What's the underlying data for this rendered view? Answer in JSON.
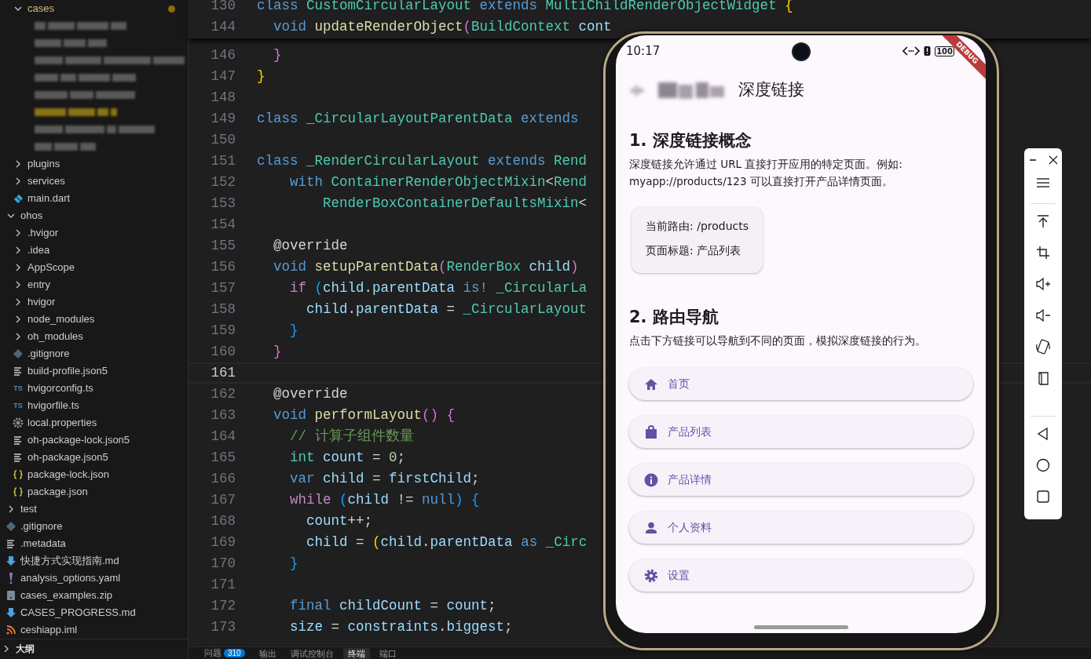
{
  "explorer": {
    "tree": [
      {
        "children": [
          {
            "label": "cases",
            "kind": "folder",
            "expanded": true,
            "modified": true,
            "children": [
              {
                "kind": "redacted",
                "modified": false
              },
              {
                "kind": "redacted",
                "modified": false
              },
              {
                "kind": "redacted",
                "modified": false
              },
              {
                "kind": "redacted",
                "modified": false
              },
              {
                "kind": "redacted",
                "modified": false
              },
              {
                "kind": "redacted",
                "modified": true
              },
              {
                "kind": "redacted",
                "modified": false
              },
              {
                "kind": "redacted",
                "modified": false
              }
            ]
          },
          {
            "label": "plugins",
            "kind": "folder",
            "expanded": false,
            "modified": false
          },
          {
            "label": "services",
            "kind": "folder",
            "expanded": false,
            "modified": false
          },
          {
            "label": "main.dart",
            "kind": "dart",
            "modified": false
          }
        ]
      },
      {
        "label": "ohos",
        "kind": "folder",
        "expanded": true,
        "modified": false,
        "children": [
          {
            "label": ".hvigor",
            "kind": "folder",
            "expanded": false,
            "modified": false
          },
          {
            "label": ".idea",
            "kind": "folder",
            "expanded": false,
            "modified": false
          },
          {
            "label": "AppScope",
            "kind": "folder",
            "expanded": false,
            "modified": false
          },
          {
            "label": "entry",
            "kind": "folder",
            "expanded": false,
            "modified": false
          },
          {
            "label": "hvigor",
            "kind": "folder",
            "expanded": false,
            "modified": false
          },
          {
            "label": "node_modules",
            "kind": "folder",
            "expanded": false,
            "modified": false
          },
          {
            "label": "oh_modules",
            "kind": "folder",
            "expanded": false,
            "modified": false
          },
          {
            "label": ".gitignore",
            "kind": "git",
            "modified": false
          },
          {
            "label": "build-profile.json5",
            "kind": "lines",
            "modified": false
          },
          {
            "label": "hvigorconfig.ts",
            "kind": "ts",
            "icon_text": "TS",
            "modified": false
          },
          {
            "label": "hvigorfile.ts",
            "kind": "ts",
            "icon_text": "TS",
            "modified": false
          },
          {
            "label": "local.properties",
            "kind": "gear",
            "modified": false
          },
          {
            "label": "oh-package-lock.json5",
            "kind": "lines",
            "modified": false
          },
          {
            "label": "oh-package.json5",
            "kind": "lines",
            "modified": false
          },
          {
            "label": "package-lock.json",
            "kind": "json",
            "modified": false
          },
          {
            "label": "package.json",
            "kind": "json",
            "modified": false
          }
        ]
      },
      {
        "label": "test",
        "kind": "folder",
        "expanded": false,
        "modified": false
      },
      {
        "label": ".gitignore",
        "kind": "git",
        "modified": false
      },
      {
        "label": ".metadata",
        "kind": "lines",
        "modified": false
      },
      {
        "label": "快捷方式实现指南.md",
        "kind": "markdown",
        "modified": false
      },
      {
        "label": "analysis_options.yaml",
        "kind": "yaml",
        "modified": false
      },
      {
        "label": "cases_examples.zip",
        "kind": "zip",
        "modified": false
      },
      {
        "label": "CASES_PROGRESS.md",
        "kind": "markdown",
        "modified": false
      },
      {
        "label": "ceshiapp.iml",
        "kind": "feed",
        "modified": false
      }
    ],
    "outline": {
      "label": "大纲",
      "expanded": false
    }
  },
  "editor": {
    "sticky_lines": [
      {
        "number": "130",
        "tokens": [
          {
            "kind": "kw",
            "text": "class"
          },
          {
            "kind": "ty",
            "text": " CustomCircularLayout"
          },
          {
            "kind": "kw",
            "text": " extends"
          },
          {
            "kind": "ty",
            "text": " MultiChildRenderObjectWidget"
          },
          {
            "kind": "b1",
            "text": " {"
          }
        ]
      },
      {
        "number": "144",
        "tokens": [
          {
            "kind": "kw",
            "text": "  void"
          },
          {
            "kind": "fn",
            "text": " updateRenderObject"
          },
          {
            "kind": "b2",
            "text": "("
          },
          {
            "kind": "ty",
            "text": "BuildContext"
          },
          {
            "kind": "va",
            "text": " cont"
          }
        ]
      }
    ],
    "lines": [
      {
        "number": "146",
        "current": false,
        "tokens": [
          {
            "kind": "b2",
            "text": "  }"
          }
        ]
      },
      {
        "number": "147",
        "current": false,
        "tokens": [
          {
            "kind": "b1",
            "text": "}"
          }
        ]
      },
      {
        "number": "148",
        "current": false
      },
      {
        "number": "149",
        "current": false,
        "tokens": [
          {
            "kind": "kw",
            "text": "class"
          },
          {
            "kind": "ty",
            "text": " _CircularLayoutParentData"
          },
          {
            "kind": "kw",
            "text": " extends"
          }
        ]
      },
      {
        "number": "150",
        "current": false
      },
      {
        "number": "151",
        "current": false,
        "tokens": [
          {
            "kind": "kw",
            "text": "class"
          },
          {
            "kind": "ty",
            "text": " _RenderCircularLayout"
          },
          {
            "kind": "kw",
            "text": " extends"
          },
          {
            "kind": "ty",
            "text": " Rend"
          }
        ]
      },
      {
        "number": "152",
        "current": false,
        "tokens": [
          {
            "kind": "kw",
            "text": "    with"
          },
          {
            "kind": "ty",
            "text": " ContainerRenderObjectMixin"
          },
          {
            "kind": "p",
            "text": "<"
          },
          {
            "kind": "ty",
            "text": "Rend"
          }
        ]
      },
      {
        "number": "153",
        "current": false,
        "tokens": [
          {
            "kind": "ty",
            "text": "        RenderBoxContainerDefaultsMixin"
          },
          {
            "kind": "p",
            "text": "<"
          }
        ]
      },
      {
        "number": "154",
        "current": false
      },
      {
        "number": "155",
        "current": false,
        "tokens": [
          {
            "kind": "p",
            "text": "  @override"
          }
        ]
      },
      {
        "number": "156",
        "current": false,
        "tokens": [
          {
            "kind": "kw",
            "text": "  void"
          },
          {
            "kind": "fn",
            "text": " setupParentData"
          },
          {
            "kind": "b2",
            "text": "("
          },
          {
            "kind": "ty",
            "text": "RenderBox"
          },
          {
            "kind": "va",
            "text": " child"
          },
          {
            "kind": "b2",
            "text": ")"
          }
        ]
      },
      {
        "number": "157",
        "current": false,
        "tokens": [
          {
            "kind": "ct",
            "text": "    if"
          },
          {
            "kind": "b3",
            "text": " ("
          },
          {
            "kind": "va",
            "text": "child"
          },
          {
            "kind": "p",
            "text": "."
          },
          {
            "kind": "va",
            "text": "parentData"
          },
          {
            "kind": "kw",
            "text": " is!"
          },
          {
            "kind": "ty",
            "text": " _CircularLa"
          }
        ]
      },
      {
        "number": "158",
        "current": false,
        "tokens": [
          {
            "kind": "va",
            "text": "      child"
          },
          {
            "kind": "p",
            "text": "."
          },
          {
            "kind": "va",
            "text": "parentData"
          },
          {
            "kind": "p",
            "text": " ="
          },
          {
            "kind": "ty",
            "text": " _CircularLayout"
          }
        ]
      },
      {
        "number": "159",
        "current": false,
        "tokens": [
          {
            "kind": "b3",
            "text": "    }"
          }
        ]
      },
      {
        "number": "160",
        "current": false,
        "tokens": [
          {
            "kind": "b2",
            "text": "  }"
          }
        ]
      },
      {
        "number": "161",
        "current": true
      },
      {
        "number": "162",
        "current": false,
        "tokens": [
          {
            "kind": "p",
            "text": "  @override"
          }
        ]
      },
      {
        "number": "163",
        "current": false,
        "tokens": [
          {
            "kind": "kw",
            "text": "  void"
          },
          {
            "kind": "fn",
            "text": " performLayout"
          },
          {
            "kind": "b2",
            "text": "()"
          },
          {
            "kind": "b2",
            "text": " {"
          }
        ]
      },
      {
        "number": "164",
        "current": false,
        "tokens": [
          {
            "kind": "cm",
            "text": "    // 计算子组件数量"
          }
        ]
      },
      {
        "number": "165",
        "current": false,
        "tokens": [
          {
            "kind": "ty",
            "text": "    int"
          },
          {
            "kind": "va",
            "text": " count"
          },
          {
            "kind": "p",
            "text": " ="
          },
          {
            "kind": "nu",
            "text": " 0"
          },
          {
            "kind": "p",
            "text": ";"
          }
        ]
      },
      {
        "number": "166",
        "current": false,
        "tokens": [
          {
            "kind": "kw",
            "text": "    var"
          },
          {
            "kind": "va",
            "text": " child"
          },
          {
            "kind": "p",
            "text": " ="
          },
          {
            "kind": "va",
            "text": " firstChild"
          },
          {
            "kind": "p",
            "text": ";"
          }
        ]
      },
      {
        "number": "167",
        "current": false,
        "tokens": [
          {
            "kind": "ct",
            "text": "    while"
          },
          {
            "kind": "b3",
            "text": " ("
          },
          {
            "kind": "va",
            "text": "child"
          },
          {
            "kind": "p",
            "text": " !="
          },
          {
            "kind": "kw",
            "text": " null"
          },
          {
            "kind": "b3",
            "text": ")"
          },
          {
            "kind": "b3",
            "text": " {"
          }
        ]
      },
      {
        "number": "168",
        "current": false,
        "tokens": [
          {
            "kind": "va",
            "text": "      count"
          },
          {
            "kind": "p",
            "text": "++;"
          }
        ]
      },
      {
        "number": "169",
        "current": false,
        "tokens": [
          {
            "kind": "va",
            "text": "      child"
          },
          {
            "kind": "p",
            "text": " ="
          },
          {
            "kind": "b1",
            "text": " ("
          },
          {
            "kind": "va",
            "text": "child"
          },
          {
            "kind": "p",
            "text": "."
          },
          {
            "kind": "va",
            "text": "parentData"
          },
          {
            "kind": "kw",
            "text": " as"
          },
          {
            "kind": "ty",
            "text": " _Circ"
          }
        ]
      },
      {
        "number": "170",
        "current": false,
        "tokens": [
          {
            "kind": "b3",
            "text": "    }"
          }
        ]
      },
      {
        "number": "171",
        "current": false
      },
      {
        "number": "172",
        "current": false,
        "tokens": [
          {
            "kind": "kw",
            "text": "    final"
          },
          {
            "kind": "va",
            "text": " childCount"
          },
          {
            "kind": "p",
            "text": " ="
          },
          {
            "kind": "va",
            "text": " count"
          },
          {
            "kind": "p",
            "text": ";"
          }
        ]
      },
      {
        "number": "173",
        "current": false,
        "tokens": [
          {
            "kind": "va",
            "text": "    size"
          },
          {
            "kind": "p",
            "text": " ="
          },
          {
            "kind": "va",
            "text": " constraints"
          },
          {
            "kind": "p",
            "text": "."
          },
          {
            "kind": "va",
            "text": "biggest"
          },
          {
            "kind": "p",
            "text": ";"
          }
        ]
      }
    ],
    "panel_tabs": [
      {
        "label": "问题",
        "badge": "310",
        "selected": false
      },
      {
        "label": "输出",
        "selected": false
      },
      {
        "label": "调试控制台",
        "selected": false
      },
      {
        "label": "终端",
        "selected": true
      },
      {
        "label": "端口",
        "selected": false
      }
    ]
  },
  "emulator": {
    "status_bar": {
      "time": "10:17",
      "battery": "100"
    },
    "debug_banner": "DEBUG",
    "app_bar": {
      "title": "深度链接"
    },
    "section_1": {
      "heading": "1. 深度链接概念",
      "text": "深度链接允许通过 URL 直接打开应用的特定页面。例如: myapp://products/123 可以直接打开产品详情页面。"
    },
    "route_card": [
      "当前路由: /products",
      "页面标题: 产品列表"
    ],
    "section_2": {
      "heading": "2. 路由导航",
      "text": "点击下方链接可以导航到不同的页面，模拟深度链接的行为。"
    },
    "nav_buttons": [
      {
        "label": "首页",
        "kind": "home"
      },
      {
        "label": "产品列表",
        "kind": "bag"
      },
      {
        "label": "产品详情",
        "kind": "info"
      },
      {
        "label": "个人资料",
        "kind": "person"
      },
      {
        "label": "设置",
        "kind": "gear"
      }
    ]
  },
  "toolbar": {
    "items": [
      {
        "kind": "minimize"
      },
      {
        "kind": "close"
      },
      {
        "kind": "menu"
      },
      {
        "kind": "divider"
      },
      {
        "kind": "pin-top"
      },
      {
        "kind": "crop"
      },
      {
        "kind": "volume-up"
      },
      {
        "kind": "volume-down"
      },
      {
        "kind": "rotate"
      },
      {
        "kind": "fold"
      },
      {
        "kind": "spacer"
      },
      {
        "kind": "divider"
      },
      {
        "kind": "back"
      },
      {
        "kind": "home"
      },
      {
        "kind": "recents"
      }
    ]
  }
}
